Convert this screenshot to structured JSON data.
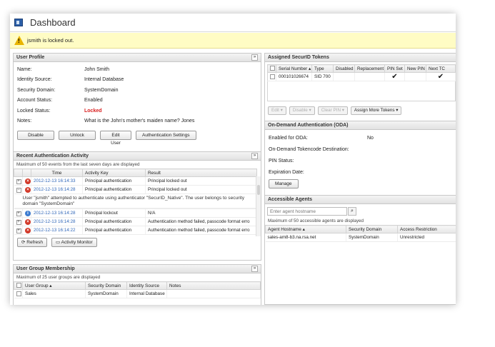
{
  "window": {
    "title": "Dashboard"
  },
  "alert": {
    "message": "jsmith is locked out."
  },
  "user_profile": {
    "title": "User Profile",
    "fields": [
      {
        "label": "Name:",
        "value": "John Smith"
      },
      {
        "label": "Identity Source:",
        "value": "Internal Database"
      },
      {
        "label": "Security Domain:",
        "value": "SystemDomain"
      },
      {
        "label": "Account Status:",
        "value": "Enabled"
      },
      {
        "label": "Locked Status:",
        "value": "Locked"
      },
      {
        "label": "Notes:",
        "value": "What is the John's mother's maiden name? Jones"
      }
    ],
    "buttons": {
      "disable": "Disable",
      "unlock": "Unlock",
      "edit_user": "Edit User",
      "auth_settings": "Authentication Settings"
    }
  },
  "recent_auth": {
    "title": "Recent Authentication Activity",
    "note": "Maximum of 50 events from the last seven days are displayed",
    "columns": {
      "time": "Time",
      "key": "Activity Key",
      "result": "Result"
    },
    "rows": [
      {
        "time": "2012-12-13 16:14:33",
        "key": "Principal authentication",
        "result": "Principal locked out",
        "icon": "error"
      },
      {
        "time": "2012-12-13 16:14:28",
        "key": "Principal authentication",
        "result": "Principal locked out",
        "icon": "error"
      },
      {
        "time": "2012-12-13 16:14:28",
        "key": "Principal lockout",
        "result": "N/A",
        "icon": "info"
      },
      {
        "time": "2012-12-13 16:14:28",
        "key": "Principal authentication",
        "result": "Authentication method failed, passcode format erro",
        "icon": "error"
      },
      {
        "time": "2012-12-13 16:14:22",
        "key": "Principal authentication",
        "result": "Authentication method failed, passcode format erro",
        "icon": "error"
      }
    ],
    "detail": "User \"jsmith\" attempted to authenticate using authenticator \"SecurID_Native\". The user belongs to security domain \"SystemDomain\"",
    "buttons": {
      "refresh": "Refresh",
      "monitor": "Activity Monitor"
    }
  },
  "group_membership": {
    "title": "User Group Membership",
    "note": "Maximum of 25 user groups are displayed",
    "columns": {
      "group": "User Group",
      "domain": "Security Domain",
      "source": "Identity Source",
      "notes": "Notes"
    },
    "rows": [
      {
        "group": "Sales",
        "domain": "SystemDomain",
        "source": "Internal Database",
        "notes": ""
      }
    ]
  },
  "tokens": {
    "title": "Assigned SecurID Tokens",
    "columns": {
      "serial": "Serial Number",
      "type": "Type",
      "disabled": "Disabled",
      "replacement": "Replacement",
      "pin_set": "PIN Set",
      "new_pin": "New PIN",
      "next_tc": "Next TC"
    },
    "rows": [
      {
        "serial": "000101026674",
        "type": "SID 700",
        "disabled": "",
        "replacement": "",
        "pin_set": true,
        "new_pin": "",
        "next_tc": true
      }
    ],
    "buttons": {
      "edit": "Edit",
      "disable": "Disable",
      "clear_pin": "Clear PIN",
      "assign": "Assign More Tokens"
    }
  },
  "oda": {
    "title": "On-Demand Authentication (ODA)",
    "fields": [
      {
        "label": "Enabled for ODA:",
        "value": "No"
      },
      {
        "label": "On-Demand Tokencode Destination:",
        "value": ""
      },
      {
        "label": "PIN Status:",
        "value": ""
      },
      {
        "label": "Expiration Date:",
        "value": ""
      }
    ],
    "manage": "Manage"
  },
  "agents": {
    "title": "Accessible Agents",
    "search_placeholder": "Enter agent hostname",
    "note": "Maximum of 50 accessible agents are displayed",
    "columns": {
      "host": "Agent Hostname",
      "domain": "Security Domain",
      "access": "Access Restriction"
    },
    "rows": [
      {
        "host": "sales-am8-b3.na.rsa.net",
        "domain": "SystemDomain",
        "access": "Unrestricted"
      }
    ]
  }
}
